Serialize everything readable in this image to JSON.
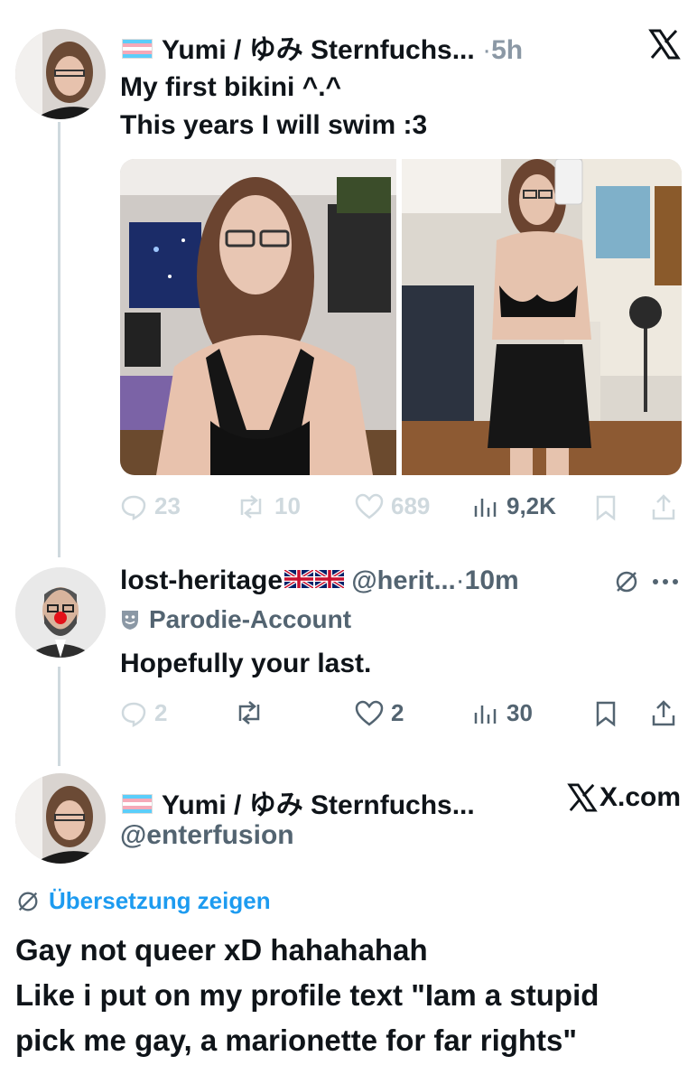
{
  "tweet1": {
    "display_name": "Yumi / ゆみ Sternfuchs...",
    "separator": "·",
    "time": "5h",
    "text_line1": "My first bikini ^.^",
    "text_line2": "This years I will swim :3",
    "images": [
      "photo-selfie-bikini",
      "photo-mirror-bikini"
    ],
    "actions": {
      "replies": "23",
      "reposts": "10",
      "likes": "689",
      "views": "9,2K"
    }
  },
  "reply": {
    "display_name": "lost-heritage",
    "handle": "@herit...",
    "separator": "·",
    "time": "10m",
    "label": "Parodie-Account",
    "text": "Hopefully your last.",
    "actions": {
      "replies": "2",
      "reposts": "",
      "likes": "2",
      "views": "30"
    }
  },
  "quote": {
    "display_name": "Yumi / ゆみ Sternfuchs...",
    "handle": "@enterfusion",
    "brand": "X.com",
    "translate_label": "Übersetzung zeigen",
    "text_line1": "Gay not queer xD hahahahah",
    "text_line2": "Like i put on my profile text \"Iam a stupid",
    "text_line3": "pick me gay, a marionette for far rights\""
  },
  "colors": {
    "accent": "#1d9bf0",
    "muted": "#cfd9de",
    "secondary": "#536471",
    "text": "#0f1419"
  },
  "icons": [
    "x-logo-icon",
    "reply-icon",
    "repost-icon",
    "like-icon",
    "views-icon",
    "bookmark-icon",
    "share-icon",
    "no-translate-icon",
    "more-icon",
    "parody-mask-icon"
  ]
}
